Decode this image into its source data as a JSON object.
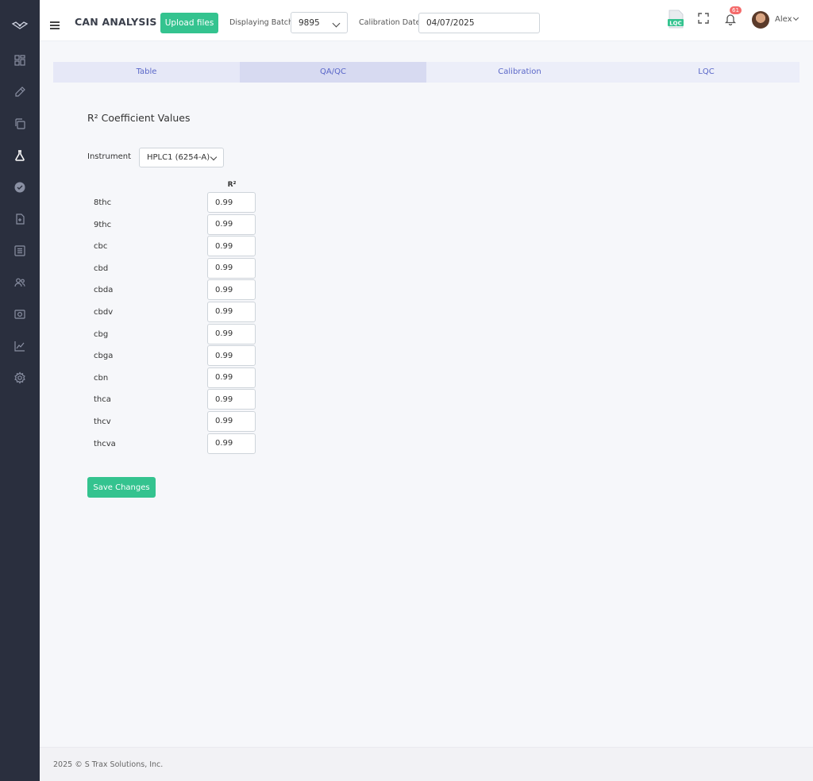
{
  "header": {
    "title": "CAN ANALYSIS",
    "upload_label": "Upload files",
    "batch_label": "Displaying Batch:",
    "batch_value": "9895",
    "calibration_label": "Calibration Date:",
    "calibration_value": "04/07/2025",
    "notification_count": "61",
    "user_name": "Alex",
    "lqc_icon_text": "LQC"
  },
  "sidebar": {
    "items": [
      "dashboard-icon",
      "pencil-icon",
      "copy-icon",
      "flask-icon",
      "badge-check-icon",
      "file-icon",
      "list-icon",
      "users-icon",
      "camera-icon",
      "chart-icon",
      "settings-icon"
    ],
    "active_index": 3
  },
  "tabs": [
    "Table",
    "QA/QC",
    "Calibration",
    "LQC"
  ],
  "active_tab": "QA/QC",
  "main": {
    "section_title": "R² Coefficient Values",
    "instrument_label": "Instrument",
    "instrument_value": "HPLC1 (6254-A)",
    "column_header": "R²",
    "rows": [
      {
        "name": "8thc",
        "value": "0.99"
      },
      {
        "name": "9thc",
        "value": "0.99"
      },
      {
        "name": "cbc",
        "value": "0.99"
      },
      {
        "name": "cbd",
        "value": "0.99"
      },
      {
        "name": "cbda",
        "value": "0.99"
      },
      {
        "name": "cbdv",
        "value": "0.99"
      },
      {
        "name": "cbg",
        "value": "0.99"
      },
      {
        "name": "cbga",
        "value": "0.99"
      },
      {
        "name": "cbn",
        "value": "0.99"
      },
      {
        "name": "thca",
        "value": "0.99"
      },
      {
        "name": "thcv",
        "value": "0.99"
      },
      {
        "name": "thcva",
        "value": "0.99"
      }
    ],
    "save_label": "Save Changes"
  },
  "footer": {
    "text": "2025 © S Trax Solutions, Inc."
  },
  "colors": {
    "sidebar_bg": "#2a2f3e",
    "accent_green": "#34c38f",
    "tab_text": "#5a67c8",
    "badge_red": "#f46a6a"
  }
}
